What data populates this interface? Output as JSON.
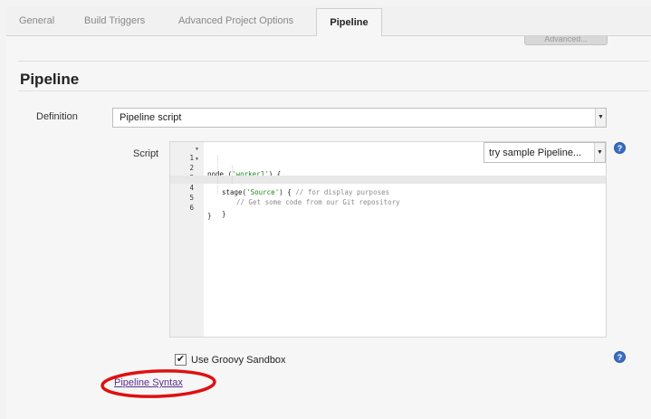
{
  "tabs": [
    {
      "label": "General"
    },
    {
      "label": "Build Triggers"
    },
    {
      "label": "Advanced Project Options"
    },
    {
      "label": "Pipeline"
    }
  ],
  "active_tab": "Pipeline",
  "advanced_button_label": "Advanced...",
  "section_title": "Pipeline",
  "definition": {
    "label": "Definition",
    "value": "Pipeline script"
  },
  "script": {
    "label": "Script",
    "lines": [
      {
        "number": "1",
        "fold": true
      },
      {
        "number": "2",
        "fold": true
      },
      {
        "number": "3",
        "fold": false
      },
      {
        "number": "4",
        "fold": false
      },
      {
        "number": "5",
        "fold": false
      },
      {
        "number": "6",
        "fold": false
      }
    ],
    "code": {
      "line1_prefix": "node (",
      "line1_string": "'worker1'",
      "line1_suffix": ") {",
      "line2_prefix": "stage(",
      "line2_string": "'Source'",
      "line2_suffix": ") { ",
      "line2_comment": "// for display purposes",
      "line3_comment": "// Get some code from our Git repository",
      "line4": "",
      "line5": "}",
      "line6": "}"
    },
    "sample_select_value": "try sample Pipeline..."
  },
  "sandbox": {
    "label": "Use Groovy Sandbox",
    "checked": true,
    "check_glyph": "✔"
  },
  "syntax_link": "Pipeline Syntax",
  "help_glyph": "?",
  "icons": {
    "dropdown": "chevron-down-icon",
    "help": "help-icon",
    "fold": "fold-arrow-icon"
  },
  "colors": {
    "help_icon": "#3a6ec4",
    "annotation": "#e01010",
    "link": "#5b2f8a"
  }
}
